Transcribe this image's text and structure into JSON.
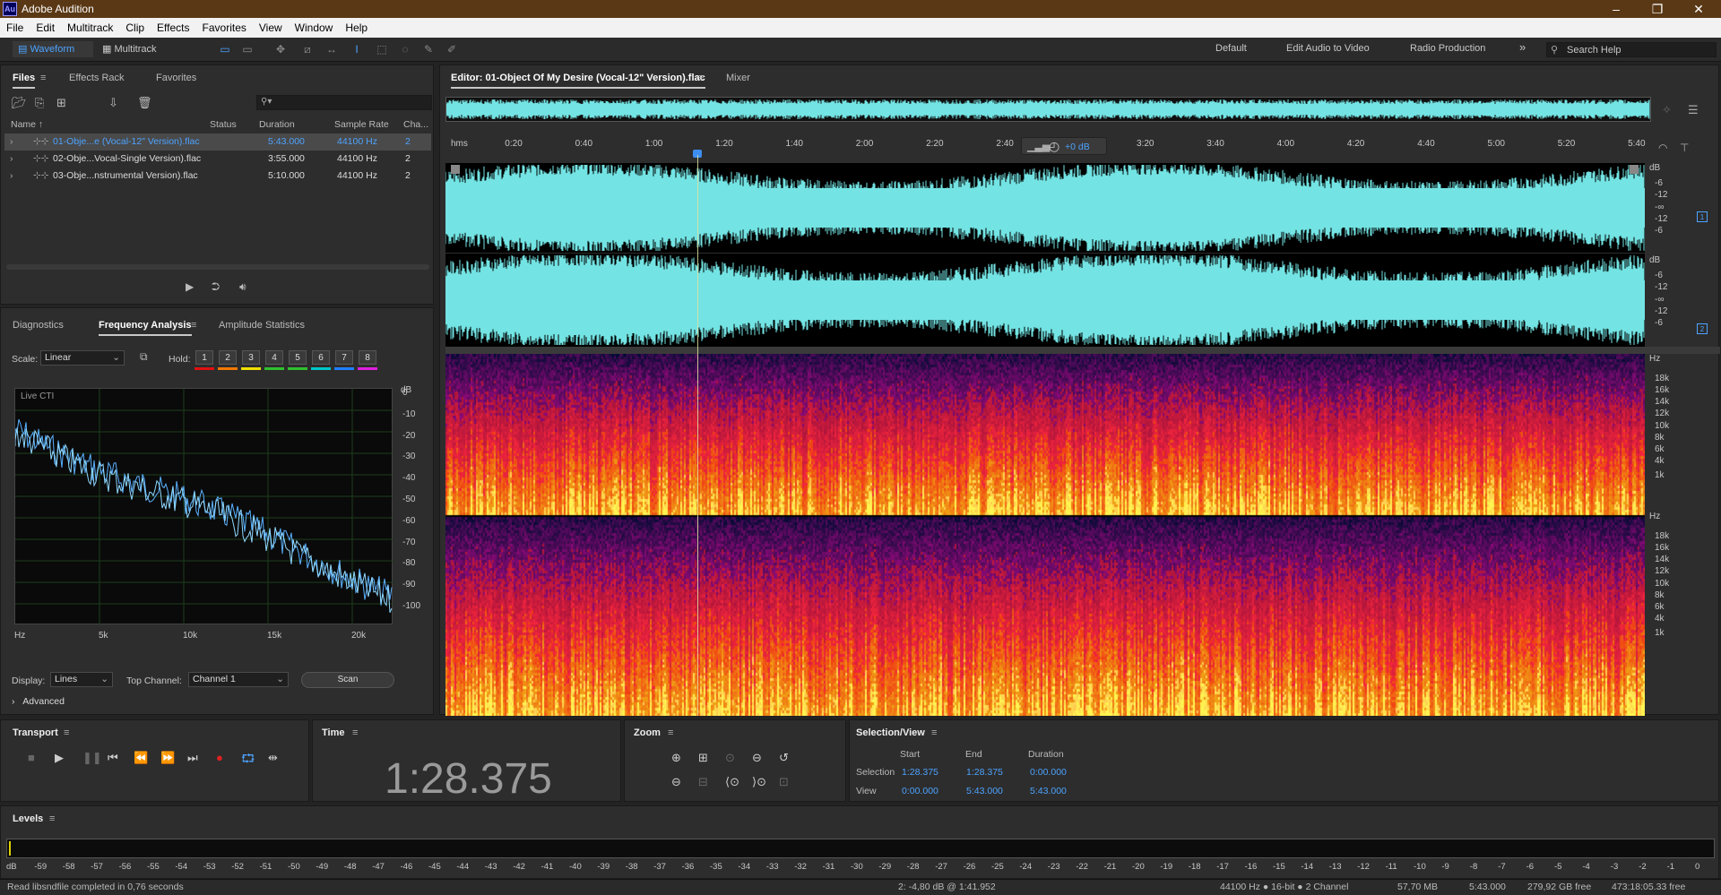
{
  "app": {
    "title": "Adobe Audition",
    "logo": "Au"
  },
  "window_controls": {
    "minimize": "–",
    "maximize": "❐",
    "close": "✕"
  },
  "menu": [
    "File",
    "Edit",
    "Multitrack",
    "Clip",
    "Effects",
    "Favorites",
    "View",
    "Window",
    "Help"
  ],
  "toolbar": {
    "waveform_label": "Waveform",
    "multitrack_label": "Multitrack",
    "workspaces": [
      "Default",
      "Edit Audio to Video",
      "Radio Production"
    ],
    "more": "»",
    "search_placeholder": "Search Help"
  },
  "files_panel": {
    "tabs": [
      "Files",
      "Effects Rack",
      "Favorites"
    ],
    "columns": [
      "Name",
      "Status",
      "Duration",
      "Sample Rate",
      "Cha..."
    ],
    "search_glyph": "⚲▾",
    "files": [
      {
        "name": "01-Obje...e (Vocal-12\" Version).flac",
        "status": "",
        "duration": "5:43.000",
        "rate": "44100 Hz",
        "channels": "2",
        "selected": true
      },
      {
        "name": "02-Obje...Vocal-Single Version).flac",
        "status": "",
        "duration": "3:55.000",
        "rate": "44100 Hz",
        "channels": "2",
        "selected": false
      },
      {
        "name": "03-Obje...nstrumental Version).flac",
        "status": "",
        "duration": "5:10.000",
        "rate": "44100 Hz",
        "channels": "2",
        "selected": false
      }
    ]
  },
  "analysis_panel": {
    "tabs": [
      "Diagnostics",
      "Frequency Analysis",
      "Amplitude Statistics"
    ],
    "scale_label": "Scale:",
    "scale_value": "Linear",
    "hold_label": "Hold:",
    "hold_buttons": [
      "1",
      "2",
      "3",
      "4",
      "5",
      "6",
      "7",
      "8"
    ],
    "hold_colors": [
      "#e01010",
      "#f07800",
      "#f0e000",
      "#30c030",
      "#30c030",
      "#00c8c8",
      "#2080ff",
      "#e020e0"
    ],
    "graph_label": "Live CTI",
    "db_unit": "dB",
    "db_ticks": [
      "0",
      "-10",
      "-20",
      "-30",
      "-40",
      "-50",
      "-60",
      "-70",
      "-80",
      "-90",
      "-100"
    ],
    "hz_ticks": [
      "Hz",
      "5k",
      "10k",
      "15k",
      "20k"
    ],
    "display_label": "Display:",
    "display_value": "Lines",
    "top_channel_label": "Top Channel:",
    "top_channel_value": "Channel 1",
    "scan_label": "Scan",
    "advanced_label": "Advanced"
  },
  "editor": {
    "tab_label": "Editor: 01-Object Of My Desire (Vocal-12\" Version).flac",
    "mixer_tab": "Mixer",
    "ruler": [
      "hms",
      "0:20",
      "0:40",
      "1:00",
      "1:20",
      "1:40",
      "2:00",
      "2:20",
      "2:40",
      "3:00",
      "3:20",
      "3:40",
      "4:00",
      "4:20",
      "4:40",
      "5:00",
      "5:20",
      "5:40"
    ],
    "hud_gain": "+0 dB",
    "db_scale_1": [
      "dB",
      "-6",
      "-12",
      "-∞",
      "-12",
      "-6"
    ],
    "db_scale_2": [
      "dB",
      "-6",
      "-12",
      "-∞",
      "-12",
      "-6"
    ],
    "channel_1": "1",
    "channel_2": "2",
    "hz_scale_1": [
      "Hz",
      "18k",
      "16k",
      "14k",
      "12k",
      "10k",
      "8k",
      "6k",
      "4k",
      "1k"
    ],
    "hz_scale_2": [
      "Hz",
      "18k",
      "16k",
      "14k",
      "12k",
      "10k",
      "8k",
      "6k",
      "4k",
      "1k"
    ],
    "waveform_color": "#73e3e3"
  },
  "transport": {
    "title": "Transport"
  },
  "time_panel": {
    "title": "Time",
    "value": "1:28.375"
  },
  "zoom_panel": {
    "title": "Zoom"
  },
  "selection_panel": {
    "title": "Selection/View",
    "headers": [
      "Start",
      "End",
      "Duration"
    ],
    "selection_label": "Selection",
    "view_label": "View",
    "selection": [
      "1:28.375",
      "1:28.375",
      "0:00.000"
    ],
    "view": [
      "0:00.000",
      "5:43.000",
      "5:43.000"
    ]
  },
  "levels": {
    "title": "Levels",
    "ticks": [
      "dB",
      "-59",
      "-58",
      "-57",
      "-56",
      "-55",
      "-54",
      "-53",
      "-52",
      "-51",
      "-50",
      "-49",
      "-48",
      "-47",
      "-46",
      "-45",
      "-44",
      "-43",
      "-42",
      "-41",
      "-40",
      "-39",
      "-38",
      "-37",
      "-36",
      "-35",
      "-34",
      "-33",
      "-32",
      "-31",
      "-30",
      "-29",
      "-28",
      "-27",
      "-26",
      "-25",
      "-24",
      "-23",
      "-22",
      "-21",
      "-20",
      "-19",
      "-18",
      "-17",
      "-16",
      "-15",
      "-14",
      "-13",
      "-12",
      "-11",
      "-10",
      "-9",
      "-8",
      "-7",
      "-6",
      "-5",
      "-4",
      "-3",
      "-2",
      "-1",
      "0"
    ]
  },
  "status_bar": {
    "message": "Read libsndfile completed in 0,76 seconds",
    "cursor": "2: -4,80 dB @ 1:41.952",
    "format": "44100 Hz ● 16-bit ● 2 Channel",
    "size": "57,70 MB",
    "duration": "5:43.000",
    "free": "279,92 GB free",
    "free_time": "473:18:05.33 free"
  }
}
